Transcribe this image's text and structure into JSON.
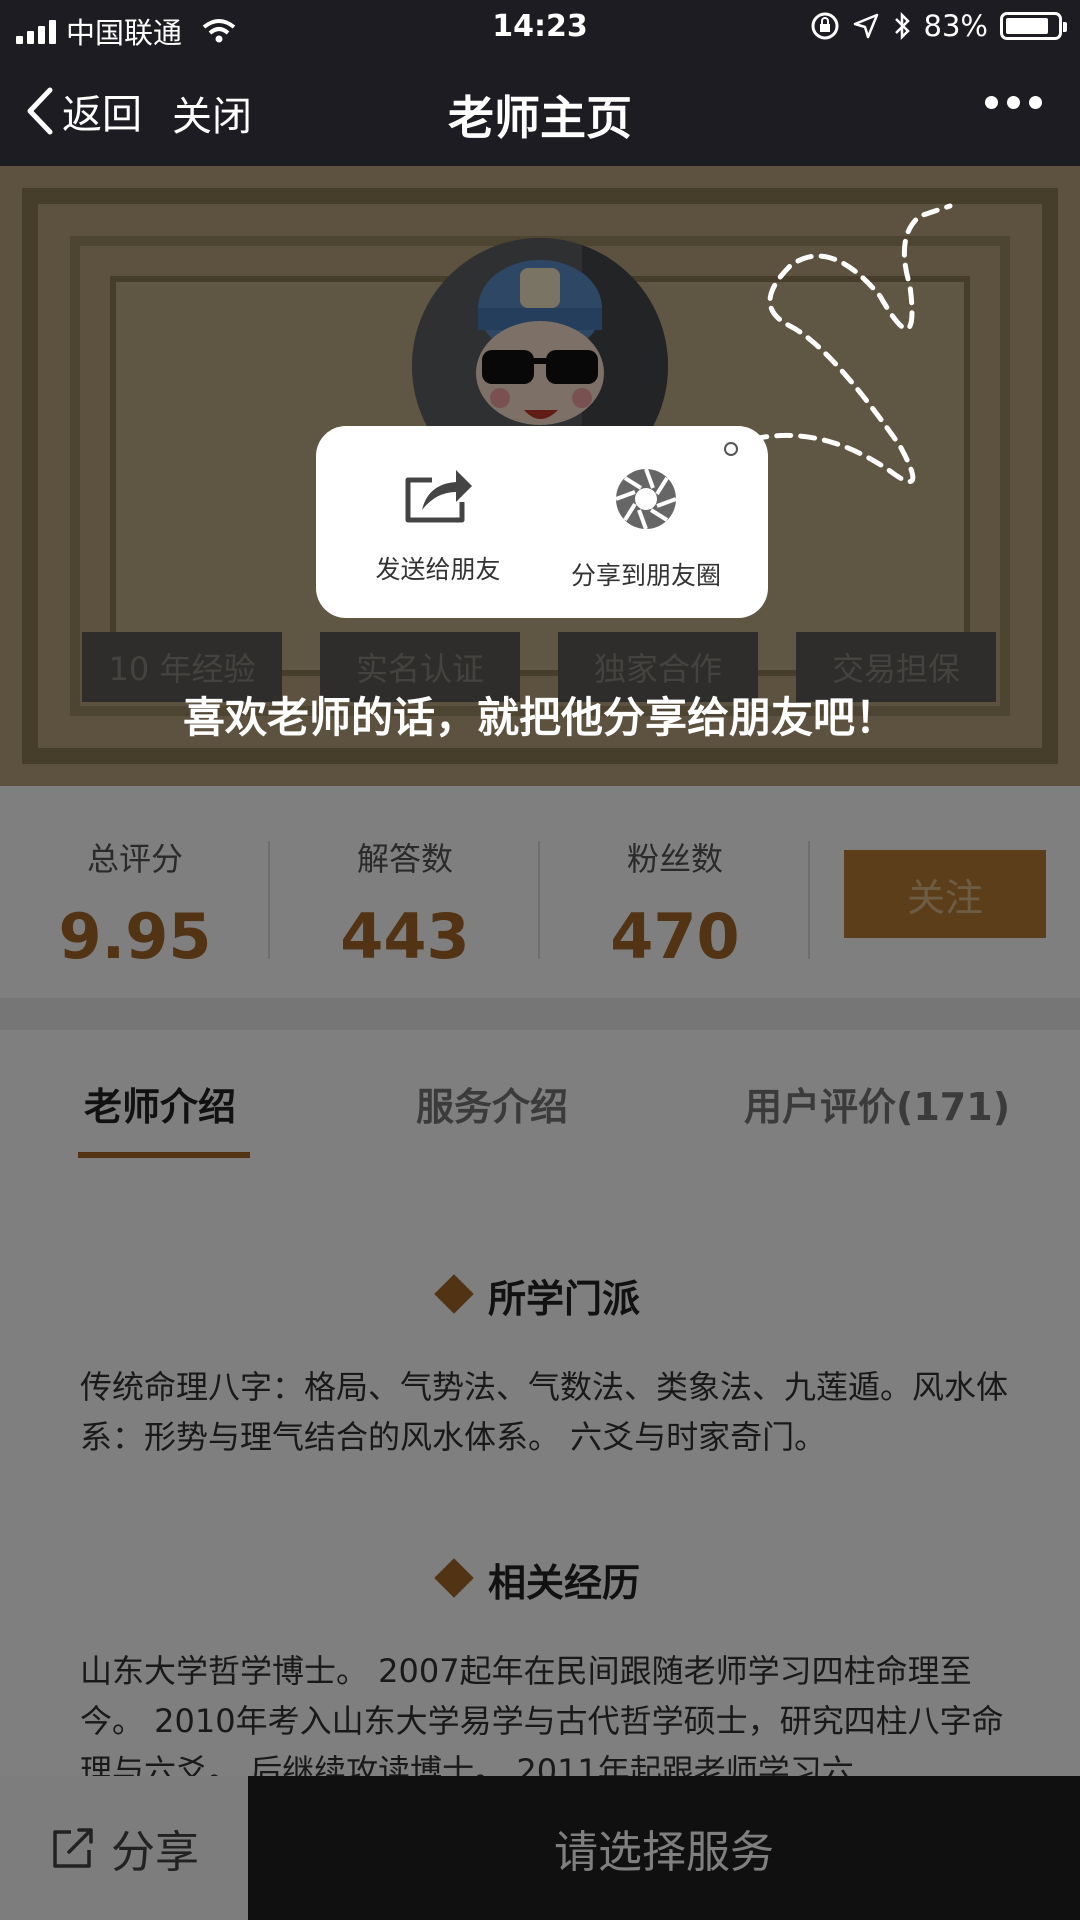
{
  "status_bar": {
    "carrier": "中国联通",
    "time": "14:23",
    "battery": "83%",
    "battery_level": 0.83
  },
  "nav": {
    "back_label": "返回",
    "close_label": "关闭",
    "title": "老师主页"
  },
  "banner": {
    "tags": [
      "10 年经验",
      "实名认证",
      "独家合作",
      "交易担保"
    ]
  },
  "stats": {
    "rating_label": "总评分",
    "rating_value": "9.95",
    "answers_label": "解答数",
    "answers_value": "443",
    "fans_label": "粉丝数",
    "fans_value": "470",
    "follow_label": "关注"
  },
  "tabs": [
    {
      "label": "老师介绍",
      "active": true
    },
    {
      "label": "服务介绍",
      "active": false
    },
    {
      "label": "用户评价(171)",
      "active": false
    }
  ],
  "sections": [
    {
      "title": "所学门派",
      "text": "传统命理八字：格局、气势法、气数法、类象法、九莲遁。风水体系：形势与理气结合的风水体系。 六爻与时家奇门。"
    },
    {
      "title": "相关经历",
      "text": "山东大学哲学博士。 2007起年在民间跟随老师学习四柱命理至今。 2010年考入山东大学易学与古代哲学硕士，研究四柱八字命理与六爻。 后继续攻读博士。 2011年起跟老师学习六"
    }
  ],
  "bottom": {
    "share_label": "分享",
    "select_label": "请选择服务"
  },
  "share_popup": {
    "send_friend_label": "发送给朋友",
    "moments_label": "分享到朋友圈"
  },
  "overlay_hint": "喜欢老师的话，就把他分享给朋友吧！",
  "colors": {
    "accent": "#a4692a",
    "follow_button": "#bb7c36",
    "nav_background": "#1c1c22"
  }
}
